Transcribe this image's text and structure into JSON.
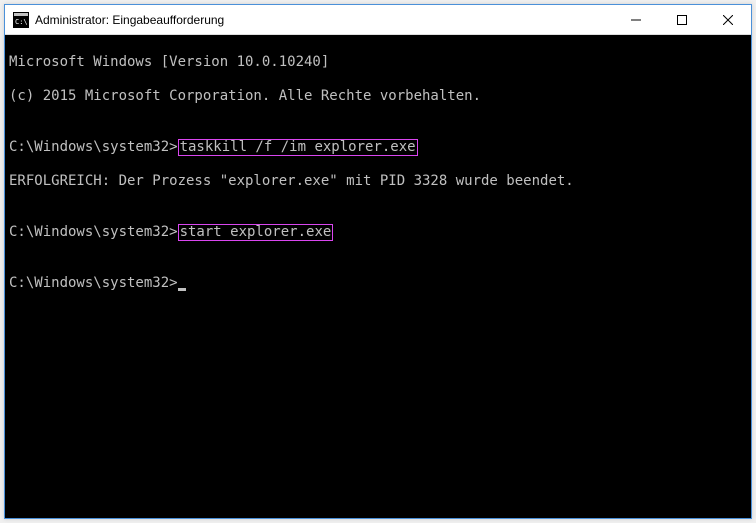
{
  "titlebar": {
    "title": "Administrator: Eingabeaufforderung"
  },
  "terminal": {
    "line1": "Microsoft Windows [Version 10.0.10240]",
    "line2": "(c) 2015 Microsoft Corporation. Alle Rechte vorbehalten.",
    "blank1": "",
    "prompt1": "C:\\Windows\\system32>",
    "cmd1": "taskkill /f /im explorer.exe",
    "result1": "ERFOLGREICH: Der Prozess \"explorer.exe\" mit PID 3328 wurde beendet.",
    "blank2": "",
    "prompt2": "C:\\Windows\\system32>",
    "cmd2": "start explorer.exe",
    "blank3": "",
    "prompt3": "C:\\Windows\\system32>"
  }
}
